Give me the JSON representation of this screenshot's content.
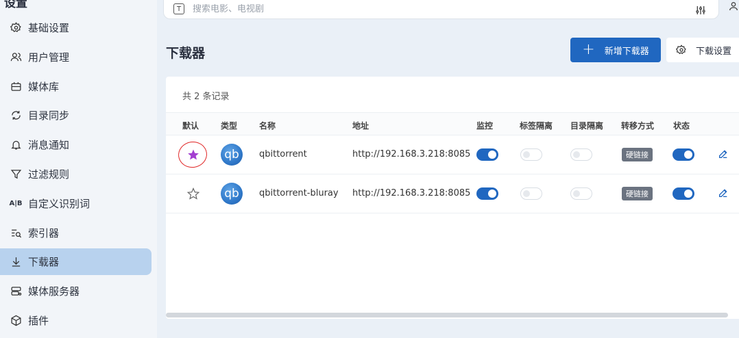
{
  "sidebar": {
    "title": "设置",
    "collapse_icon": "chevron-up-icon",
    "items": [
      {
        "label": "基础设置",
        "icon": "gear-icon"
      },
      {
        "label": "用户管理",
        "icon": "users-icon"
      },
      {
        "label": "媒体库",
        "icon": "library-icon"
      },
      {
        "label": "目录同步",
        "icon": "sync-icon"
      },
      {
        "label": "消息通知",
        "icon": "bell-icon"
      },
      {
        "label": "过滤规则",
        "icon": "filter-icon"
      },
      {
        "label": "自定义识别词",
        "icon": "ab-icon"
      },
      {
        "label": "索引器",
        "icon": "indexer-icon"
      },
      {
        "label": "下载器",
        "icon": "download-icon",
        "active": true
      },
      {
        "label": "媒体服务器",
        "icon": "server-icon"
      },
      {
        "label": "插件",
        "icon": "plugin-icon"
      }
    ]
  },
  "search": {
    "placeholder": "搜索电影、电视剧",
    "prefix_icon": "t-icon"
  },
  "page": {
    "title": "下载器",
    "add_button": "新增下载器",
    "settings_button": "下载设置"
  },
  "table": {
    "count_text": "共 2 条记录",
    "headers": [
      "默认",
      "类型",
      "名称",
      "地址",
      "监控",
      "标签隔离",
      "目录隔离",
      "转移方式",
      "状态"
    ],
    "rows": [
      {
        "default": true,
        "type_label": "qb",
        "name": "qbittorrent",
        "address": "http://192.168.3.218:8085",
        "monitor": true,
        "tag_isolation": false,
        "dir_isolation": false,
        "transfer": "硬链接",
        "status": true
      },
      {
        "default": false,
        "type_label": "qb",
        "name": "qbittorrent-bluray",
        "address": "http://192.168.3.218:8085",
        "monitor": true,
        "tag_isolation": false,
        "dir_isolation": false,
        "transfer": "硬链接",
        "status": true
      }
    ]
  },
  "colors": {
    "accent": "#2067c0",
    "active_nav": "#b8d2ee",
    "star_default": "#a33fd1",
    "annotation": "#e02424"
  }
}
